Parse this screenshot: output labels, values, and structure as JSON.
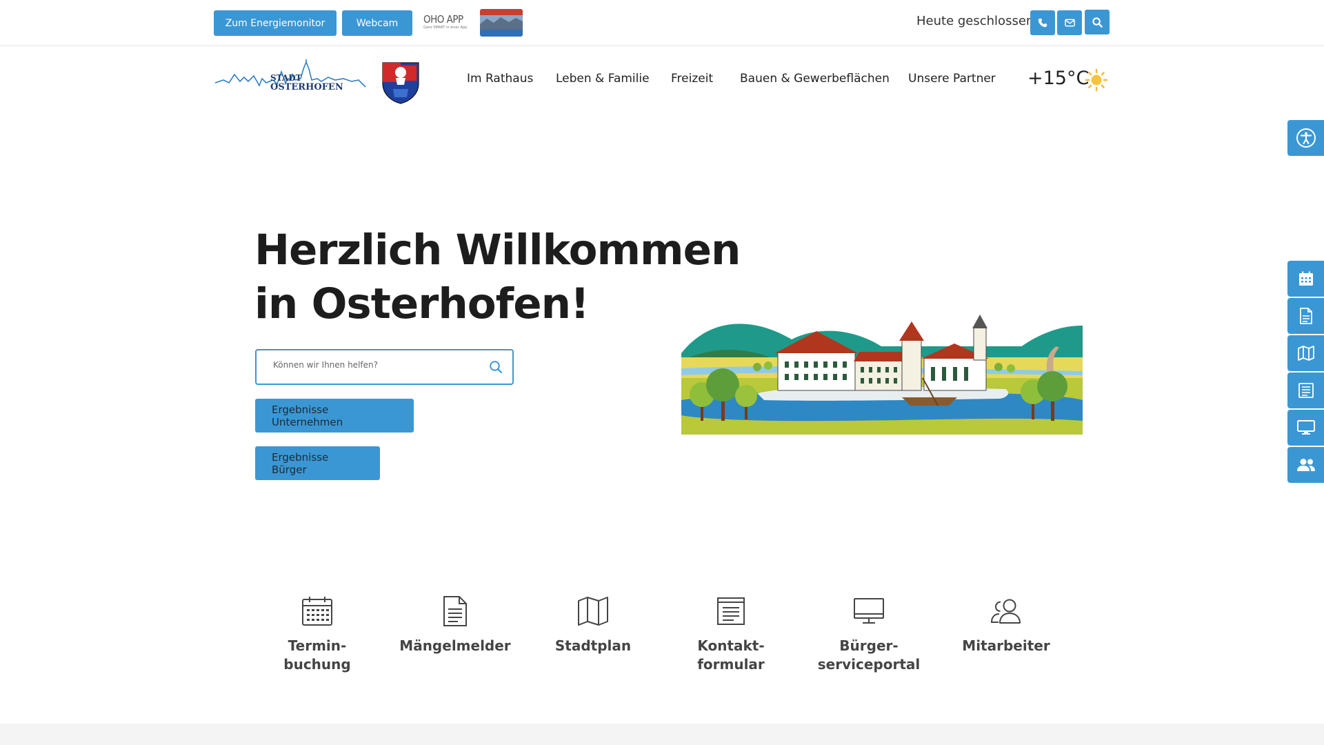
{
  "topbar": {
    "energy_button": "Zum Energiemonitor",
    "webcam_button": "Webcam",
    "app_logo_text": "OHO APP",
    "app_logo_sub": "Ganz SMART in einer App",
    "opening_status": "Heute geschlossen",
    "phone_icon": "phone-icon",
    "mail_icon": "mail-icon",
    "search_icon": "search-icon"
  },
  "header": {
    "logo_text_line1": "STADT",
    "logo_text_line2": "OSTERHOFEN",
    "nav": [
      "Im Rathaus",
      "Leben & Familie",
      "Freizeit",
      "Bauen & Gewerbeflächen",
      "Unsere Partner"
    ],
    "temperature": "+15°C",
    "weather_icon": "sun-icon"
  },
  "side_tabs": [
    "accessibility-icon",
    "calendar-icon",
    "document-icon",
    "map-icon",
    "form-icon",
    "monitor-icon",
    "users-icon"
  ],
  "hero": {
    "title_line1": "Herzlich Willkommen",
    "title_line2": "in Osterhofen!",
    "search_placeholder": "Können wir Ihnen helfen?",
    "button_companies": "Ergebnisse Unternehmen",
    "button_citizens": "Ergebnisse Bürger"
  },
  "quick_links": [
    {
      "line1": "Termin-",
      "line2": "buchung",
      "icon": "calendar-icon"
    },
    {
      "line1": "Mängelmelder",
      "line2": "",
      "icon": "document-icon"
    },
    {
      "line1": "Stadtplan",
      "line2": "",
      "icon": "map-icon"
    },
    {
      "line1": "Kontakt-",
      "line2": "formular",
      "icon": "form-icon"
    },
    {
      "line1": "Bürger-",
      "line2": "serviceportal",
      "icon": "monitor-icon"
    },
    {
      "line1": "Mitarbeiter",
      "line2": "",
      "icon": "users-icon"
    }
  ],
  "colors": {
    "accent": "#3b97d4",
    "text": "#1d1d1d",
    "muted": "#444444"
  }
}
